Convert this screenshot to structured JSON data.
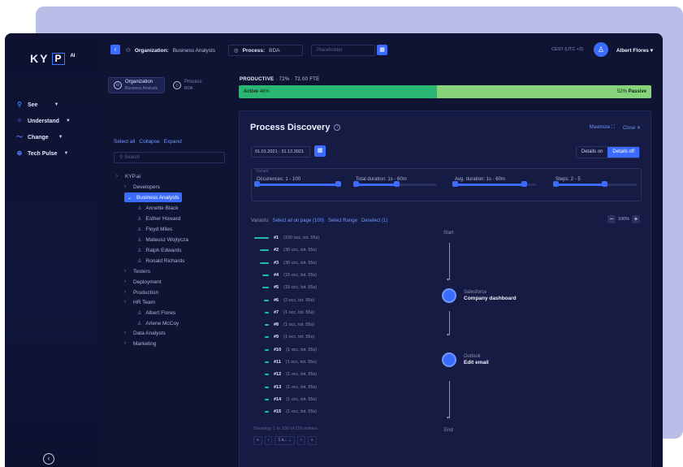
{
  "app": {
    "logo_text": "KY",
    "logo_p": "P",
    "logo_ai": "AI"
  },
  "nav": {
    "items": [
      {
        "label": "See",
        "icon": "eye-icon"
      },
      {
        "label": "Understand",
        "icon": "dots-icon"
      },
      {
        "label": "Change",
        "icon": "wave-icon"
      },
      {
        "label": "Tech Pulse",
        "icon": "pulse-icon"
      }
    ]
  },
  "topbar": {
    "org_label": "Organization:",
    "org_value": "Business Analysts",
    "proc_label": "Process:",
    "proc_value": "BDA",
    "placeholder": "Placeholder",
    "timezone": "CEST (UTC +2)",
    "user": "Albert Flores"
  },
  "tree": {
    "tab_org": "Organization",
    "tab_org_sub": "Business Analysts",
    "tab_proc": "Process",
    "tab_proc_sub": "BDA",
    "select_all": "Select all",
    "collapse": "Collapse",
    "expand": "Expand",
    "search_placeholder": "Search",
    "root": "KYP.ai",
    "groups": [
      "Developers",
      "Business Analysts",
      "Testers",
      "Deployment",
      "Production",
      "HR Team",
      "Data Analysts",
      "Marketing"
    ],
    "ba_people": [
      "Annette Black",
      "Esther Howard",
      "Floyd Miles",
      "Mateusz Wojtycza",
      "Ralph Edwards",
      "Ronald Richards"
    ],
    "hr_people": [
      "Albert Flores",
      "Arlene McCoy"
    ]
  },
  "main": {
    "productive_label": "PRODUCTIVE",
    "productive_pct": "72%",
    "productive_fte": "72.00 FTE",
    "active_label": "Active",
    "active_pct": "48%",
    "active_fraction": 0.48,
    "passive_label": "Passive",
    "passive_pct": "52%"
  },
  "panel": {
    "title": "Process Discovery",
    "maximize": "Maximize",
    "close": "Close",
    "date_range": "01.01.2021 - 31.12.2021",
    "details_on": "Details on",
    "details_off": "Details off",
    "variant_label": "Variant",
    "sliders": [
      {
        "label": "Occurences: 1 - 100",
        "from": 0.0,
        "to": 1.0
      },
      {
        "label": "Total duration: 1s - 60m",
        "from": 0.0,
        "to": 0.5
      },
      {
        "label": "Avg. duration: 1s - 60m",
        "from": 0.0,
        "to": 0.85
      },
      {
        "label": "Steps: 2 - 5",
        "from": 0.0,
        "to": 0.6
      }
    ],
    "variants_label": "Variants",
    "select_all_page": "Select all on page (100)",
    "select_range": "Select Range",
    "deselect": "Deselect (1)",
    "zoom": "100%",
    "variants": [
      {
        "id": "#1",
        "detail": "(100 occ, tot. 55s)",
        "share": 1.0
      },
      {
        "id": "#2",
        "detail": "(30 occ, tot. 55s)",
        "share": 0.6
      },
      {
        "id": "#3",
        "detail": "(30 occ, tot. 55s)",
        "share": 0.6
      },
      {
        "id": "#4",
        "detail": "(15 occ, tot. 55s)",
        "share": 0.45
      },
      {
        "id": "#5",
        "detail": "(15 occ, tot. 55s)",
        "share": 0.45
      },
      {
        "id": "#6",
        "detail": "(2 occ, tot. 55s)",
        "share": 0.35
      },
      {
        "id": "#7",
        "detail": "(1 occ, tot. 55s)",
        "share": 0.3
      },
      {
        "id": "#8",
        "detail": "(1 occ, tot. 55s)",
        "share": 0.3
      },
      {
        "id": "#9",
        "detail": "(1 occ, tot. 55s)",
        "share": 0.3
      },
      {
        "id": "#10",
        "detail": "(1 occ, tot. 55s)",
        "share": 0.3
      },
      {
        "id": "#11",
        "detail": "(1 occ, tot. 55s)",
        "share": 0.3
      },
      {
        "id": "#12",
        "detail": "(1 occ, tot. 55s)",
        "share": 0.3
      },
      {
        "id": "#13",
        "detail": "(1 occ, tot. 55s)",
        "share": 0.3
      },
      {
        "id": "#14",
        "detail": "(1 occ, tot. 55s)",
        "share": 0.3
      },
      {
        "id": "#15",
        "detail": "(1 occ, tot. 55s)",
        "share": 0.3
      }
    ],
    "showing": "Showing: 1 to 100 of 250 entries",
    "pager_page": "1 o...",
    "flow_start": "Start",
    "flow_end": "End",
    "node1_app": "Salesforce",
    "node1_action": "Company dashboard",
    "node2_app": "Outlook",
    "node2_action": "Edit email"
  },
  "colors": {
    "accent": "#3b6cff",
    "active": "#2bb673",
    "passive": "#86d37a",
    "bg": "#0f1432"
  }
}
